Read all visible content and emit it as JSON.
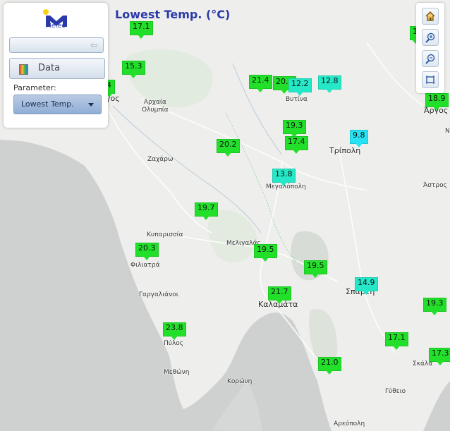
{
  "title": "Lowest Temp. (°C)",
  "logo": {
    "text": "Meteo"
  },
  "panel": {
    "data_label": "Data",
    "parameter_label": "Parameter:",
    "parameter_value": "Lowest Temp."
  },
  "controls": {
    "home": "home-icon",
    "zoom_in": "zoom-in-icon",
    "zoom_out": "zoom-out-icon",
    "full_extent": "full-extent-icon"
  },
  "colors": {
    "accent": "#2b3aa8",
    "green": "#22e02a",
    "cyan": "#25e8c8",
    "aqua": "#26e2f2"
  },
  "places": [
    {
      "id": "argos-w",
      "name": "γος"
    },
    {
      "id": "archaia-olympia",
      "name": "Αρχαία\nΟλυμπία"
    },
    {
      "id": "vytina",
      "name": "Βυτίνα"
    },
    {
      "id": "argos",
      "name": "Άργος"
    },
    {
      "id": "zacharo",
      "name": "Ζαχάρω"
    },
    {
      "id": "tripoli",
      "name": "Τρίπολη"
    },
    {
      "id": "megalopoli",
      "name": "Μεγαλόπολη"
    },
    {
      "id": "astros",
      "name": "Άστρος"
    },
    {
      "id": "kyparissia",
      "name": "Κυπαρισσία"
    },
    {
      "id": "meligalas",
      "name": "Μελιγαλάς"
    },
    {
      "id": "filiatra",
      "name": "Φιλιατρά"
    },
    {
      "id": "gargalianoi",
      "name": "Γαργαλιάνοι"
    },
    {
      "id": "sparti",
      "name": "Σπάρτη"
    },
    {
      "id": "kalamata",
      "name": "Καλαμάτα"
    },
    {
      "id": "pylos",
      "name": "Πύλος"
    },
    {
      "id": "skala",
      "name": "Σκάλα"
    },
    {
      "id": "methoni",
      "name": "Μεθώνη"
    },
    {
      "id": "koroni",
      "name": "Κορώνη"
    },
    {
      "id": "gytheio",
      "name": "Γύθειο"
    },
    {
      "id": "areopoli",
      "name": "Αρεόπολη"
    },
    {
      "id": "n",
      "name": "Ν"
    }
  ],
  "stations": [
    {
      "v": "17.1",
      "c": "green"
    },
    {
      "v": "15.3",
      "c": "green"
    },
    {
      "v": "4",
      "c": "green"
    },
    {
      "v": "21.4",
      "c": "green"
    },
    {
      "v": "20.1",
      "c": "green"
    },
    {
      "v": "12.2",
      "c": "cyan"
    },
    {
      "v": "12.8",
      "c": "cyan"
    },
    {
      "v": "18.9",
      "c": "green"
    },
    {
      "v": "1",
      "c": "green"
    },
    {
      "v": "19.3",
      "c": "green"
    },
    {
      "v": "17.4",
      "c": "green"
    },
    {
      "v": "9.8",
      "c": "aqua"
    },
    {
      "v": "20.2",
      "c": "green"
    },
    {
      "v": "13.8",
      "c": "cyan"
    },
    {
      "v": "19.7",
      "c": "green"
    },
    {
      "v": "19.5",
      "c": "green"
    },
    {
      "v": "20.3",
      "c": "green"
    },
    {
      "v": "19.5",
      "c": "green"
    },
    {
      "v": "14.9",
      "c": "cyan"
    },
    {
      "v": "21.7",
      "c": "green"
    },
    {
      "v": "19.3",
      "c": "green"
    },
    {
      "v": "23.8",
      "c": "green"
    },
    {
      "v": "17.1",
      "c": "green"
    },
    {
      "v": "17.3",
      "c": "green"
    },
    {
      "v": "21.0",
      "c": "green"
    }
  ]
}
